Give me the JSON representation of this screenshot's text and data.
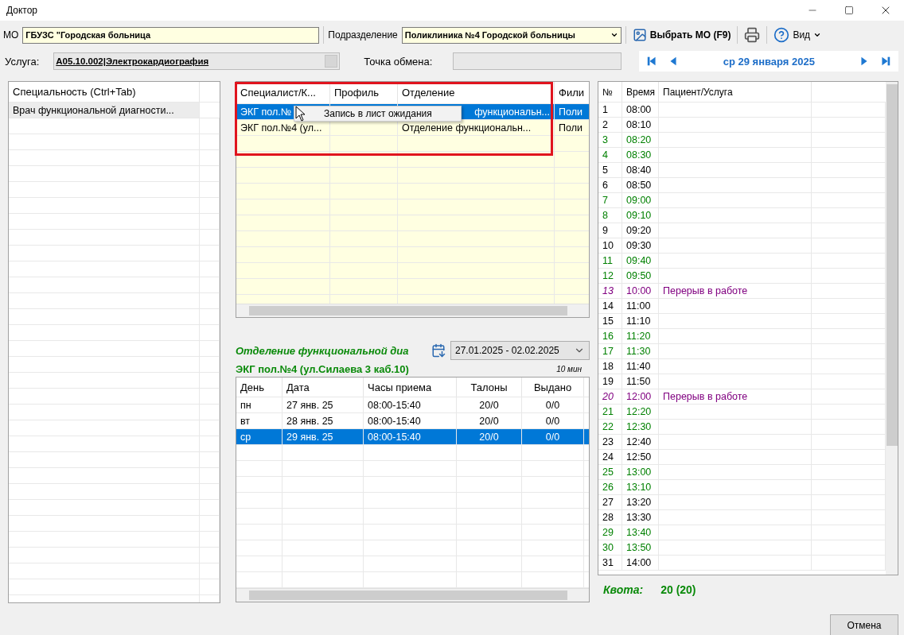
{
  "window": {
    "title": "Доктор"
  },
  "toolbar": {
    "mo_label": "МО",
    "mo_value": "ГБУЗС \"Городская больница",
    "division_label": "Подразделение",
    "division_value": "Поликлиника №4 Городской больницы",
    "select_mo_button": "Выбрать МО (F9)",
    "view_menu": "Вид"
  },
  "service": {
    "label": "Услуга:",
    "value": "A05.10.002|Электрокардиография",
    "exchange_label": "Точка обмена:"
  },
  "date_nav": {
    "date": "ср 29 января 2025"
  },
  "specialties": {
    "header": "Специальность (Ctrl+Tab)",
    "items": [
      {
        "label": "Врач функциональной диагности...",
        "selected": true
      }
    ]
  },
  "specialists": {
    "columns": [
      "Специалист/К...",
      "Профиль",
      "Отделение",
      "Фили"
    ],
    "rows": [
      {
        "specialist": "ЭКГ пол.№",
        "department": "функциональн...",
        "branch": "Поли",
        "selected": true
      },
      {
        "specialist": "ЭКГ пол.№4 (ул...",
        "department": "Отделение функциональн...",
        "branch": "Поли",
        "selected": false
      }
    ]
  },
  "context_menu": {
    "items": [
      {
        "label": "Запись в лист ожидания"
      }
    ]
  },
  "department": {
    "title": "Отделение функциональной диа",
    "period": "27.01.2025 - 02.02.2025",
    "specialist": "ЭКГ пол.№4 (ул.Силаева 3  каб.10)",
    "slot": "10 мин"
  },
  "days": {
    "columns": [
      "День",
      "Дата",
      "Часы приема",
      "Талоны",
      "Выдано"
    ],
    "rows": [
      {
        "day": "пн",
        "date": "27 янв. 25",
        "hours": "08:00-15:40",
        "tickets": "20/0",
        "issued": "0/0",
        "selected": false
      },
      {
        "day": "вт",
        "date": "28 янв. 25",
        "hours": "08:00-15:40",
        "tickets": "20/0",
        "issued": "0/0",
        "selected": false
      },
      {
        "day": "ср",
        "date": "29 янв. 25",
        "hours": "08:00-15:40",
        "tickets": "20/0",
        "issued": "0/0",
        "selected": true
      }
    ]
  },
  "schedule": {
    "columns": [
      "№",
      "Время",
      "Пациент/Услуга"
    ],
    "rows": [
      {
        "n": "1",
        "time": "08:00",
        "kind": "slot",
        "color": "#000000"
      },
      {
        "n": "2",
        "time": "08:10",
        "kind": "slot",
        "color": "#000000"
      },
      {
        "n": "3",
        "time": "08:20",
        "kind": "slot",
        "color": "#008000"
      },
      {
        "n": "4",
        "time": "08:30",
        "kind": "slot",
        "color": "#008000"
      },
      {
        "n": "5",
        "time": "08:40",
        "kind": "slot",
        "color": "#000000"
      },
      {
        "n": "6",
        "time": "08:50",
        "kind": "slot",
        "color": "#000000"
      },
      {
        "n": "7",
        "time": "09:00",
        "kind": "slot",
        "color": "#008000"
      },
      {
        "n": "8",
        "time": "09:10",
        "kind": "slot",
        "color": "#008000"
      },
      {
        "n": "9",
        "time": "09:20",
        "kind": "slot",
        "color": "#000000"
      },
      {
        "n": "10",
        "time": "09:30",
        "kind": "slot",
        "color": "#000000"
      },
      {
        "n": "11",
        "time": "09:40",
        "kind": "slot",
        "color": "#008000"
      },
      {
        "n": "12",
        "time": "09:50",
        "kind": "slot",
        "color": "#008000"
      },
      {
        "n": "13",
        "time": "10:00",
        "kind": "break",
        "note": "Перерыв в работе",
        "color": "#800080"
      },
      {
        "n": "14",
        "time": "11:00",
        "kind": "slot",
        "color": "#000000"
      },
      {
        "n": "15",
        "time": "11:10",
        "kind": "slot",
        "color": "#000000"
      },
      {
        "n": "16",
        "time": "11:20",
        "kind": "slot",
        "color": "#008000"
      },
      {
        "n": "17",
        "time": "11:30",
        "kind": "slot",
        "color": "#008000"
      },
      {
        "n": "18",
        "time": "11:40",
        "kind": "slot",
        "color": "#000000"
      },
      {
        "n": "19",
        "time": "11:50",
        "kind": "slot",
        "color": "#000000"
      },
      {
        "n": "20",
        "time": "12:00",
        "kind": "break",
        "note": "Перерыв в работе",
        "color": "#800080"
      },
      {
        "n": "21",
        "time": "12:20",
        "kind": "slot",
        "color": "#008000"
      },
      {
        "n": "22",
        "time": "12:30",
        "kind": "slot",
        "color": "#008000"
      },
      {
        "n": "23",
        "time": "12:40",
        "kind": "slot",
        "color": "#000000"
      },
      {
        "n": "24",
        "time": "12:50",
        "kind": "slot",
        "color": "#000000"
      },
      {
        "n": "25",
        "time": "13:00",
        "kind": "slot",
        "color": "#008000"
      },
      {
        "n": "26",
        "time": "13:10",
        "kind": "slot",
        "color": "#008000"
      },
      {
        "n": "27",
        "time": "13:20",
        "kind": "slot",
        "color": "#000000"
      },
      {
        "n": "28",
        "time": "13:30",
        "kind": "slot",
        "color": "#000000"
      },
      {
        "n": "29",
        "time": "13:40",
        "kind": "slot",
        "color": "#008000"
      },
      {
        "n": "30",
        "time": "13:50",
        "kind": "slot",
        "color": "#008000"
      },
      {
        "n": "31",
        "time": "14:00",
        "kind": "slot",
        "color": "#000000"
      }
    ]
  },
  "quota": {
    "label": "Квота:",
    "value": "20 (20)"
  },
  "cancel_button": "Отмена"
}
